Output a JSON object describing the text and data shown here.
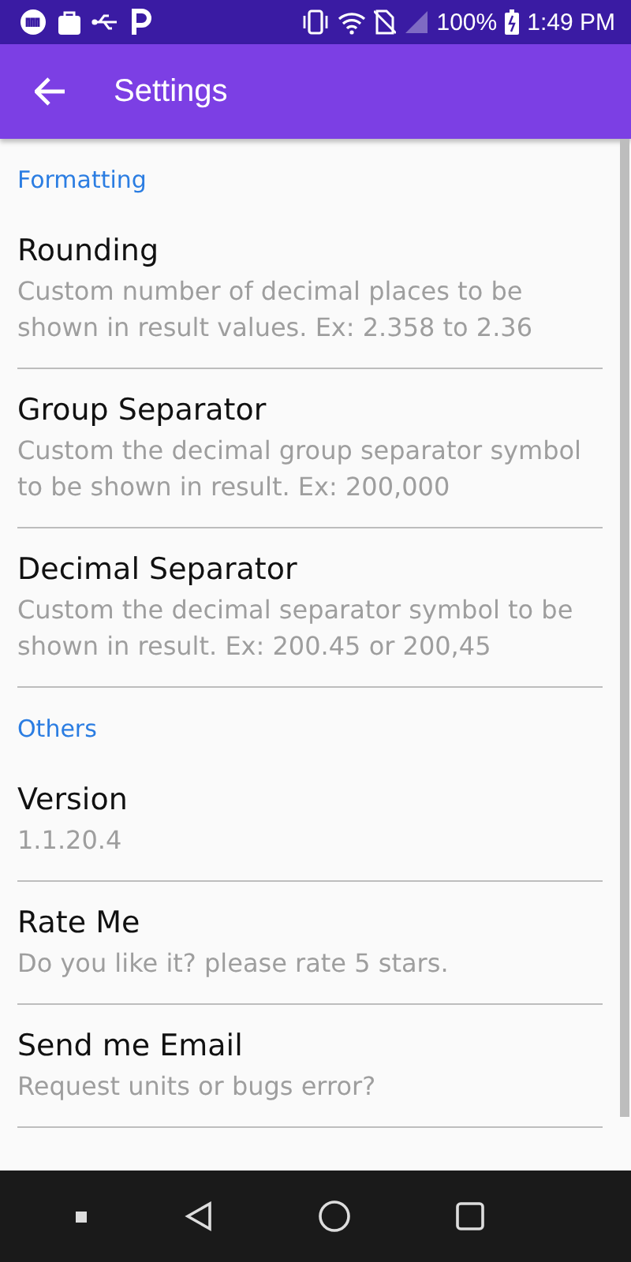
{
  "status_bar": {
    "battery": "100%",
    "time": "1:49 PM"
  },
  "app_bar": {
    "title": "Settings"
  },
  "sections": [
    {
      "header": "Formatting",
      "items": [
        {
          "title": "Rounding",
          "summary": "Custom number of decimal places to be shown in result values. Ex: 2.358 to 2.36"
        },
        {
          "title": "Group Separator",
          "summary": "Custom the decimal group separator symbol to be shown in result. Ex: 200,000"
        },
        {
          "title": "Decimal Separator",
          "summary": "Custom the decimal separator symbol to be shown in result. Ex: 200.45 or 200,45"
        }
      ]
    },
    {
      "header": "Others",
      "items": [
        {
          "title": "Version",
          "summary": "1.1.20.4"
        },
        {
          "title": "Rate Me",
          "summary": "Do you like it? please rate 5 stars."
        },
        {
          "title": "Send me Email",
          "summary": "Request units or bugs error?"
        }
      ]
    }
  ]
}
